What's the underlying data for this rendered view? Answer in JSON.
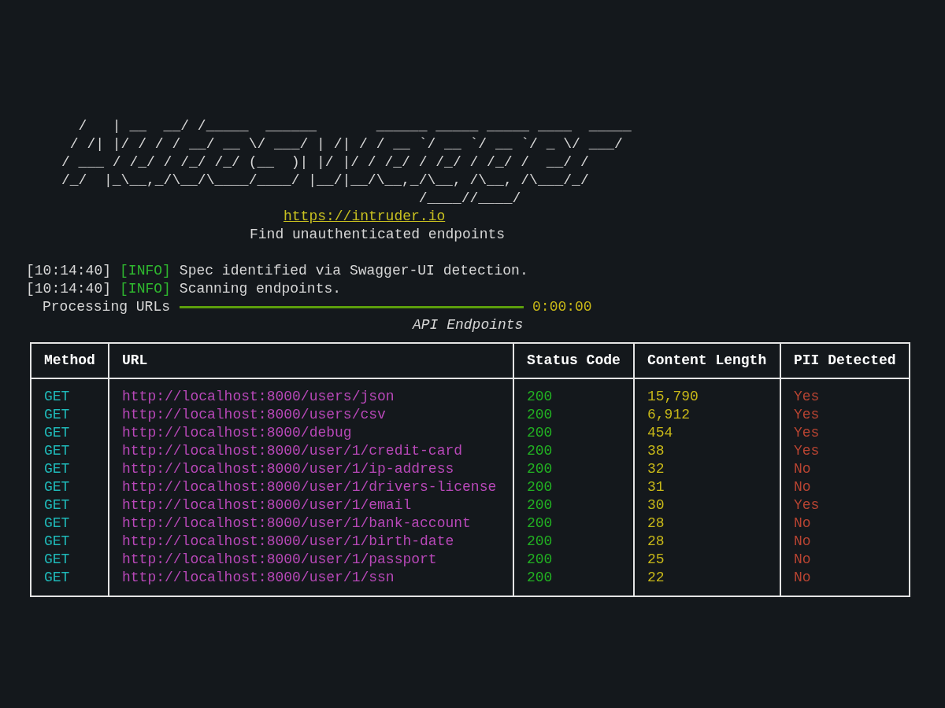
{
  "banner": {
    "ascii_art": [
      "  /   | __  __/ /_____  ______       ______ _____ _____ ____  _____",
      " / /| |/ / / / __/ __ \\/ ___/ | /| / / __ `/ __ `/ __ `/ _ \\/ ___/",
      "/ ___ / /_/ / /_/ /_/ (__  )| |/ |/ / /_/ / /_/ / /_/ /  __/ /",
      "/_/  |_\\__,_/\\__/\\____/____/ |__/|__/\\__,_/\\__, /\\__, /\\___/_/",
      "                                          /____//____/"
    ],
    "link": "https://intruder.io",
    "tagline": "Find unauthenticated endpoints"
  },
  "log": [
    {
      "time": "[10:14:40]",
      "level": "[INFO]",
      "message": "Spec identified via Swagger-UI detection."
    },
    {
      "time": "[10:14:40]",
      "level": "[INFO]",
      "message": "Scanning endpoints."
    }
  ],
  "progress": {
    "label": "Processing URLs",
    "level": 1,
    "elapsed": "0:00:00"
  },
  "table": {
    "title": "API Endpoints",
    "columns": [
      "Method",
      "URL",
      "Status Code",
      "Content Length",
      "PII Detected"
    ],
    "rows": [
      {
        "method": "GET",
        "url": "http://localhost:8000/users/json",
        "status": "200",
        "length": "15,790",
        "pii": "Yes"
      },
      {
        "method": "GET",
        "url": "http://localhost:8000/users/csv",
        "status": "200",
        "length": "6,912",
        "pii": "Yes"
      },
      {
        "method": "GET",
        "url": "http://localhost:8000/debug",
        "status": "200",
        "length": "454",
        "pii": "Yes"
      },
      {
        "method": "GET",
        "url": "http://localhost:8000/user/1/credit-card",
        "status": "200",
        "length": "38",
        "pii": "Yes"
      },
      {
        "method": "GET",
        "url": "http://localhost:8000/user/1/ip-address",
        "status": "200",
        "length": "32",
        "pii": "No"
      },
      {
        "method": "GET",
        "url": "http://localhost:8000/user/1/drivers-license",
        "status": "200",
        "length": "31",
        "pii": "No"
      },
      {
        "method": "GET",
        "url": "http://localhost:8000/user/1/email",
        "status": "200",
        "length": "30",
        "pii": "Yes"
      },
      {
        "method": "GET",
        "url": "http://localhost:8000/user/1/bank-account",
        "status": "200",
        "length": "28",
        "pii": "No"
      },
      {
        "method": "GET",
        "url": "http://localhost:8000/user/1/birth-date",
        "status": "200",
        "length": "28",
        "pii": "No"
      },
      {
        "method": "GET",
        "url": "http://localhost:8000/user/1/passport",
        "status": "200",
        "length": "25",
        "pii": "No"
      },
      {
        "method": "GET",
        "url": "http://localhost:8000/user/1/ssn",
        "status": "200",
        "length": "22",
        "pii": "No"
      }
    ]
  }
}
